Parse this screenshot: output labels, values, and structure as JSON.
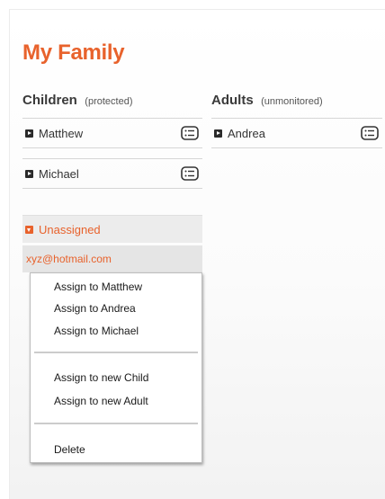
{
  "page": {
    "title": "My Family"
  },
  "children_section": {
    "heading": "Children",
    "note": "(protected)",
    "members": [
      "Matthew",
      "Michael"
    ]
  },
  "adults_section": {
    "heading": "Adults",
    "note": "(unmonitored)",
    "members": [
      "Andrea"
    ]
  },
  "unassigned": {
    "label": "Unassigned",
    "email": "xyz@hotmail.com"
  },
  "context_menu": {
    "assign_matthew": "Assign to Matthew",
    "assign_andrea": "Assign to Andrea",
    "assign_michael": "Assign to Michael",
    "assign_new_child": "Assign to new Child",
    "assign_new_adult": "Assign to new Adult",
    "delete": "Delete"
  },
  "colors": {
    "accent": "#e8622c",
    "text": "#333333",
    "divider": "#d6d6d6"
  },
  "icons": {
    "member_card": "profile-card-icon",
    "row_marker": "expand-arrow-icon"
  }
}
